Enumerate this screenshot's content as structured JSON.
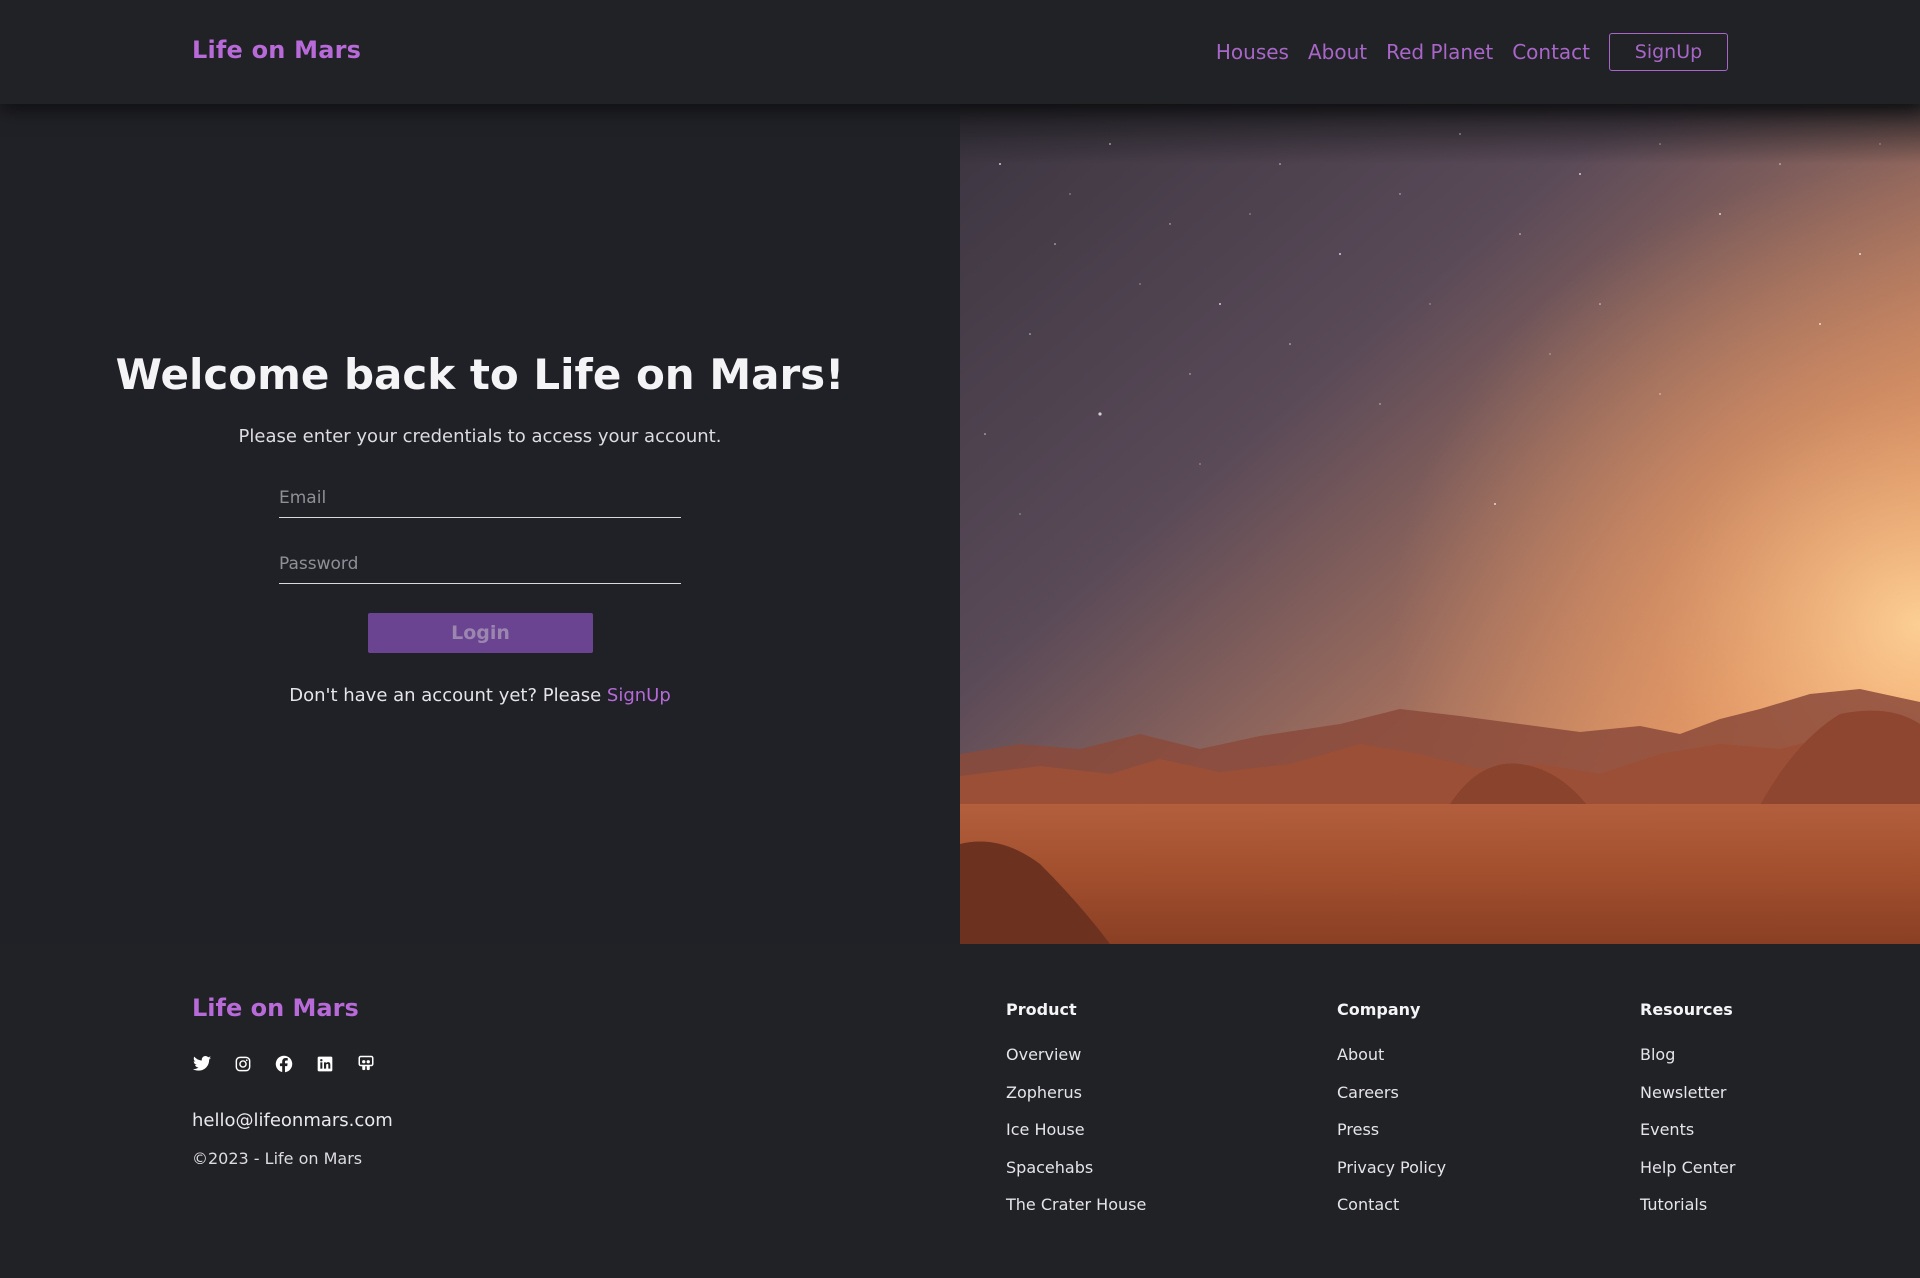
{
  "navbar": {
    "brand": "Life on Mars",
    "links": [
      "Houses",
      "About",
      "Red Planet",
      "Contact"
    ],
    "signup_label": "SignUp"
  },
  "login": {
    "title": "Welcome back to Life on Mars!",
    "subtitle": "Please enter your credentials to access your account.",
    "email_placeholder": "Email",
    "password_placeholder": "Password",
    "login_label": "Login",
    "prompt_text": "Don't have an account yet? Please ",
    "signup_link": "SignUp"
  },
  "footer": {
    "brand": "Life on Mars",
    "social_icons": [
      "twitter-icon",
      "instagram-icon",
      "facebook-icon",
      "linkedin-icon",
      "slideshare-icon"
    ],
    "email": "hello@lifeonmars.com",
    "copyright": "©2023 - Life on Mars",
    "columns": [
      {
        "title": "Product",
        "links": [
          "Overview",
          "Zopherus",
          "Ice House",
          "Spacehabs",
          "The Crater House"
        ]
      },
      {
        "title": "Company",
        "links": [
          "About",
          "Careers",
          "Press",
          "Privacy Policy",
          "Contact"
        ]
      },
      {
        "title": "Resources",
        "links": [
          "Blog",
          "Newsletter",
          "Events",
          "Help Center",
          "Tutorials"
        ]
      }
    ]
  },
  "colors": {
    "background": "#202126",
    "accent": "#b86ad9",
    "button": "#6a4490"
  }
}
